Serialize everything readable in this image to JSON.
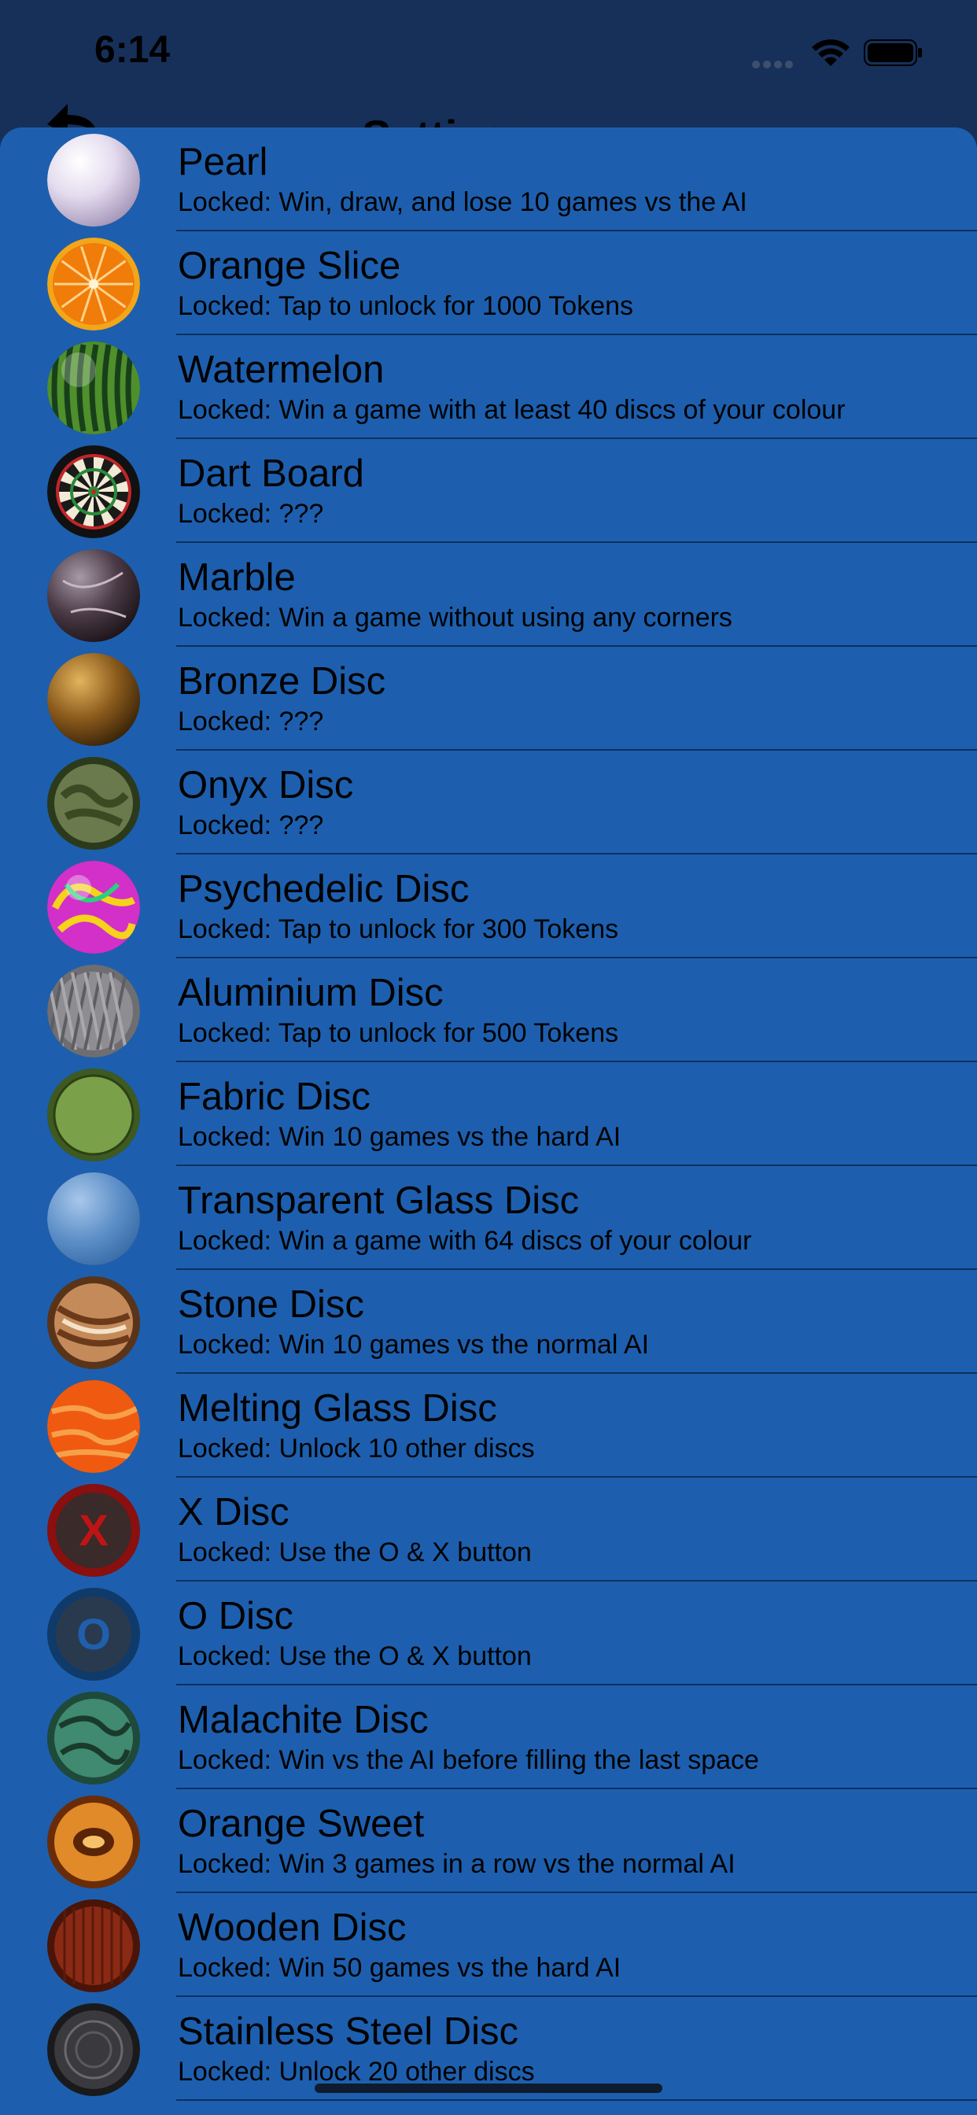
{
  "status_bar": {
    "time": "6:14"
  },
  "nav": {
    "title": "Settings",
    "back_icon": "back-arrow-icon"
  },
  "discs": [
    {
      "title": "Pearl",
      "subtitle": "Locked: Win, draw, and lose 10 games vs the AI",
      "icon": "pearl-disc-icon"
    },
    {
      "title": "Orange Slice",
      "subtitle": "Locked: Tap to unlock for 1000 Tokens",
      "icon": "orange-slice-disc-icon"
    },
    {
      "title": "Watermelon",
      "subtitle": "Locked: Win a game with at least 40 discs of your colour",
      "icon": "watermelon-disc-icon"
    },
    {
      "title": "Dart Board",
      "subtitle": "Locked: ???",
      "icon": "dart-board-disc-icon"
    },
    {
      "title": "Marble",
      "subtitle": "Locked: Win a game without using any corners",
      "icon": "marble-disc-icon"
    },
    {
      "title": "Bronze Disc",
      "subtitle": "Locked: ???",
      "icon": "bronze-disc-icon"
    },
    {
      "title": "Onyx Disc",
      "subtitle": "Locked: ???",
      "icon": "onyx-disc-icon"
    },
    {
      "title": "Psychedelic Disc",
      "subtitle": "Locked: Tap to unlock for 300 Tokens",
      "icon": "psychedelic-disc-icon"
    },
    {
      "title": "Aluminium Disc",
      "subtitle": "Locked: Tap to unlock for 500 Tokens",
      "icon": "aluminium-disc-icon"
    },
    {
      "title": "Fabric Disc",
      "subtitle": "Locked: Win 10 games vs the hard AI",
      "icon": "fabric-disc-icon"
    },
    {
      "title": "Transparent Glass Disc",
      "subtitle": "Locked: Win a game with 64 discs of your colour",
      "icon": "transparent-glass-disc-icon"
    },
    {
      "title": "Stone Disc",
      "subtitle": "Locked: Win 10 games vs the normal AI",
      "icon": "stone-disc-icon"
    },
    {
      "title": "Melting Glass Disc",
      "subtitle": "Locked: Unlock 10 other discs",
      "icon": "melting-glass-disc-icon"
    },
    {
      "title": "X Disc",
      "subtitle": "Locked: Use the O & X button",
      "icon": "x-disc-icon",
      "glyph": "X"
    },
    {
      "title": "O Disc",
      "subtitle": "Locked: Use the O & X button",
      "icon": "o-disc-icon",
      "glyph": "O"
    },
    {
      "title": "Malachite Disc",
      "subtitle": "Locked: Win vs the AI before filling the last space",
      "icon": "malachite-disc-icon"
    },
    {
      "title": "Orange Sweet",
      "subtitle": "Locked: Win 3 games in a row vs the normal AI",
      "icon": "orange-sweet-disc-icon"
    },
    {
      "title": "Wooden Disc",
      "subtitle": "Locked: Win 50 games vs the hard AI",
      "icon": "wooden-disc-icon"
    },
    {
      "title": "Stainless Steel Disc",
      "subtitle": "Locked: Unlock 20 other discs",
      "icon": "stainless-steel-disc-icon"
    }
  ]
}
